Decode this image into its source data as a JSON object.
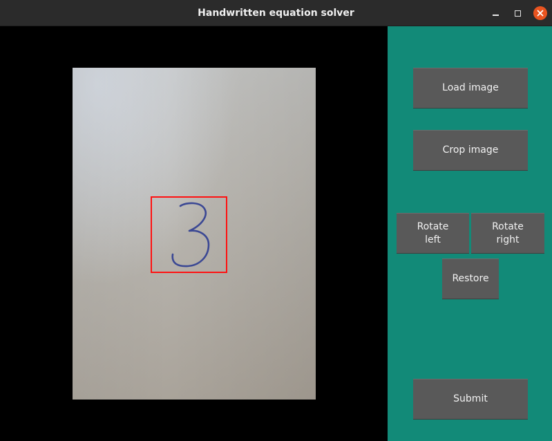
{
  "window": {
    "title": "Handwritten equation solver",
    "controls": [
      "minimize-icon",
      "maximize-icon",
      "close-icon"
    ],
    "close_color": "#e95420"
  },
  "image_panel": {
    "digit_shown": "3",
    "bounding_box_color": "#ff1010"
  },
  "controls": {
    "load_label": "Load image",
    "crop_label": "Crop image",
    "rotate_left_label": "Rotate\nleft",
    "rotate_right_label": "Rotate\nright",
    "restore_label": "Restore",
    "submit_label": "Submit"
  },
  "colors": {
    "panel_bg": "#128a78",
    "button_bg": "#595959",
    "titlebar_bg": "#2b2b2b"
  }
}
